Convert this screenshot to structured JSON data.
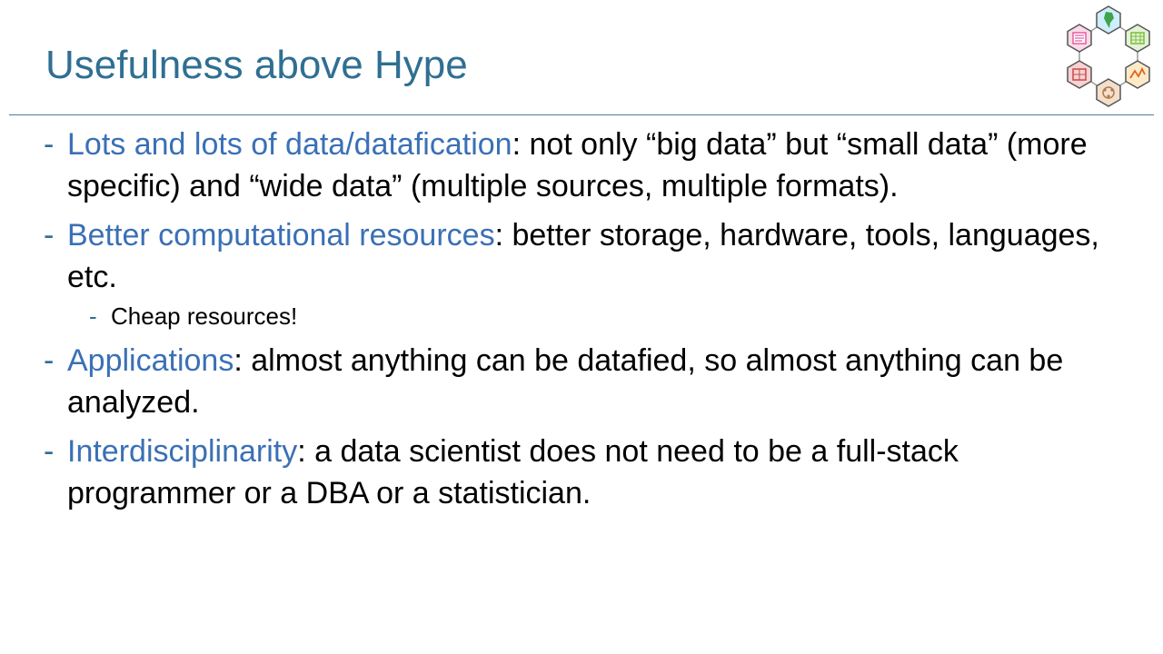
{
  "slide": {
    "title": "Usefulness above Hype",
    "bullets": [
      {
        "key": "Lots and lots of data/datafication",
        "rest": ": not only “big data” but “small data” (more specific) and “wide data” (multiple sources, multiple formats)."
      },
      {
        "key": "Better computational resources",
        "rest": ": better storage, hardware, tools, languages, etc."
      },
      {
        "key": "Applications",
        "rest": ": almost anything can be datafied, so almost anything can be analyzed."
      },
      {
        "key": "Interdisciplinarity",
        "rest": ": a data scientist does not need to be a full-stack programmer or a DBA or a statistician."
      }
    ],
    "sub_bullet": "Cheap resources!",
    "dash": "-"
  },
  "logo": {
    "icon": "hexagon-cluster-logo-icon",
    "colors": [
      "#e23b8a",
      "#2aa8d8",
      "#7cbf3c",
      "#f2a21d",
      "#d99a6c",
      "#c84b4b"
    ]
  },
  "colors": {
    "title": "#2f6f93",
    "keyword": "#3a70b5",
    "rule": "#4a7f9e"
  }
}
